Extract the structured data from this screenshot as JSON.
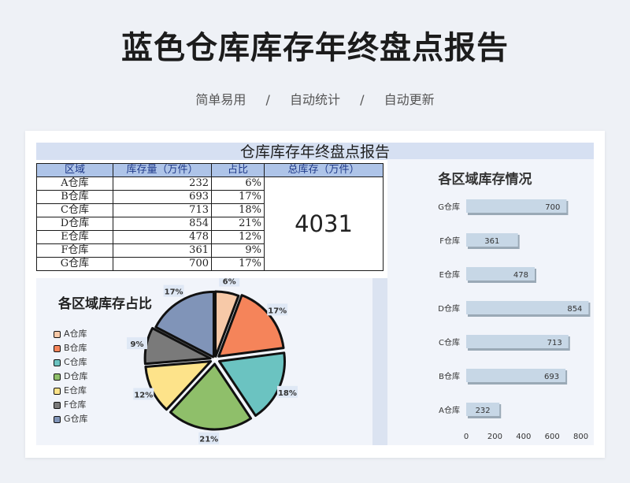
{
  "header": {
    "title": "蓝色仓库库存年终盘点报告",
    "tags": [
      "简单易用",
      "自动统计",
      "自动更新"
    ],
    "separator": "/"
  },
  "sheet": {
    "title": "仓库库存年终盘点报告",
    "columns": [
      "区域",
      "库存量（万件）",
      "占比",
      "总库存（万件）"
    ],
    "rows": [
      {
        "name": "A仓库",
        "qty": "232",
        "pct": "6%"
      },
      {
        "name": "B仓库",
        "qty": "693",
        "pct": "17%"
      },
      {
        "name": "C仓库",
        "qty": "713",
        "pct": "18%"
      },
      {
        "name": "D仓库",
        "qty": "854",
        "pct": "21%"
      },
      {
        "name": "E仓库",
        "qty": "478",
        "pct": "12%"
      },
      {
        "name": "F仓库",
        "qty": "361",
        "pct": "9%"
      },
      {
        "name": "G仓库",
        "qty": "700",
        "pct": "17%"
      }
    ],
    "total": "4031"
  },
  "colors": {
    "A": "#f7c9a8",
    "B": "#f5845a",
    "C": "#6bc3c1",
    "D": "#8fbf6a",
    "E": "#fde38a",
    "F": "#7a7a7a",
    "G": "#8094b8",
    "bar": "#c7d7e6",
    "accent_header": "#aec4e8"
  },
  "chart_data": [
    {
      "type": "pie",
      "title": "各区域库存占比",
      "categories": [
        "A仓库",
        "B仓库",
        "C仓库",
        "D仓库",
        "E仓库",
        "F仓库",
        "G仓库"
      ],
      "values": [
        232,
        693,
        713,
        854,
        478,
        361,
        700
      ],
      "labels": [
        "6%",
        "17%",
        "18%",
        "21%",
        "12%",
        "9%",
        "17%"
      ],
      "legend": "left"
    },
    {
      "type": "bar",
      "orientation": "horizontal",
      "title": "各区域库存情况",
      "categories": [
        "G仓库",
        "F仓库",
        "E仓库",
        "D仓库",
        "C仓库",
        "B仓库",
        "A仓库"
      ],
      "values": [
        700,
        361,
        478,
        854,
        713,
        693,
        232
      ],
      "xlim": [
        0,
        1000
      ],
      "xticks": [
        "0",
        "200",
        "400",
        "600",
        "800",
        "1000"
      ]
    }
  ]
}
